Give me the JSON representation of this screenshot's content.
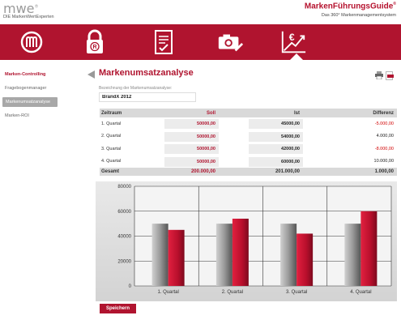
{
  "header": {
    "logo": "mwe",
    "logo_sup": "®",
    "logo_sub": "DIE MarkenWertExperten",
    "brand_title": "MarkenFührungsGuide",
    "brand_sup": "®",
    "brand_sub": "Das 360° Markenmanagementsystem"
  },
  "nav": {
    "icons": [
      "m-logo-icon",
      "lock-icon",
      "checklist-icon",
      "camera-icon",
      "euro-chart-icon"
    ],
    "active_index": 4,
    "accent": "#b0142f"
  },
  "sidebar": {
    "items": [
      {
        "label": "Marken-Controlling",
        "type": "head"
      },
      {
        "label": "Fragebogenmanager",
        "type": "normal"
      },
      {
        "label": "Markenumsatzanalyse",
        "type": "active"
      },
      {
        "label": "Marken-ROI",
        "type": "normal"
      }
    ]
  },
  "main": {
    "title": "Markenumsatzanalyse",
    "field_label": "Bezeichnung der Markenumsatzanalyse:",
    "field_value": "BrandX 2012"
  },
  "table": {
    "headers": {
      "zeitraum": "Zeitraum",
      "soll": "Soll",
      "ist": "Ist",
      "differenz": "Differenz"
    },
    "rows": [
      {
        "zeitraum": "1. Quartal",
        "soll": "50000,00",
        "ist": "45000,00",
        "differenz": "-5.000,00"
      },
      {
        "zeitraum": "2. Quartal",
        "soll": "50000,00",
        "ist": "54000,00",
        "differenz": "4.000,00"
      },
      {
        "zeitraum": "3. Quartal",
        "soll": "50000,00",
        "ist": "42000,00",
        "differenz": "-8.000,00"
      },
      {
        "zeitraum": "4. Quartal",
        "soll": "50000,00",
        "ist": "60000,00",
        "differenz": "10.000,00"
      }
    ],
    "total": {
      "label": "Gesamt",
      "soll": "200.000,00",
      "ist": "201.000,00",
      "differenz": "1.000,00"
    }
  },
  "chart_data": {
    "type": "bar",
    "categories": [
      "1. Quartal",
      "2. Quartal",
      "3. Quartal",
      "4. Quartal"
    ],
    "series": [
      {
        "values": [
          50000,
          50000,
          50000,
          50000
        ],
        "color": "#8e8e8e"
      },
      {
        "values": [
          45000,
          54000,
          42000,
          60000
        ],
        "color": "#c8102e"
      }
    ],
    "y_ticks": [
      "0",
      "20000",
      "40000",
      "60000",
      "80000"
    ],
    "ylim": [
      0,
      80000
    ],
    "grid": true
  },
  "save_label": "Speichern"
}
